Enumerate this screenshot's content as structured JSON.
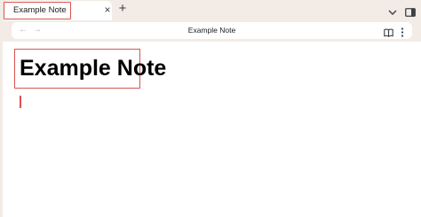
{
  "tab": {
    "title": "Example Note",
    "close_glyph": "×"
  },
  "tabstrip": {
    "new_tab_glyph": "+",
    "tab_list_icon": "chevron-down-icon",
    "side_panel_icon": "side-panel-icon"
  },
  "toolbar": {
    "back_glyph": "←",
    "forward_glyph": "→",
    "omnibox_title": "Example Note",
    "reader_icon": "book-icon",
    "menu_icon": "kebab-menu-icon"
  },
  "document": {
    "heading": "Example Note"
  },
  "colors": {
    "highlight": "#d9534f",
    "chrome_bg": "#f2ebe6"
  }
}
